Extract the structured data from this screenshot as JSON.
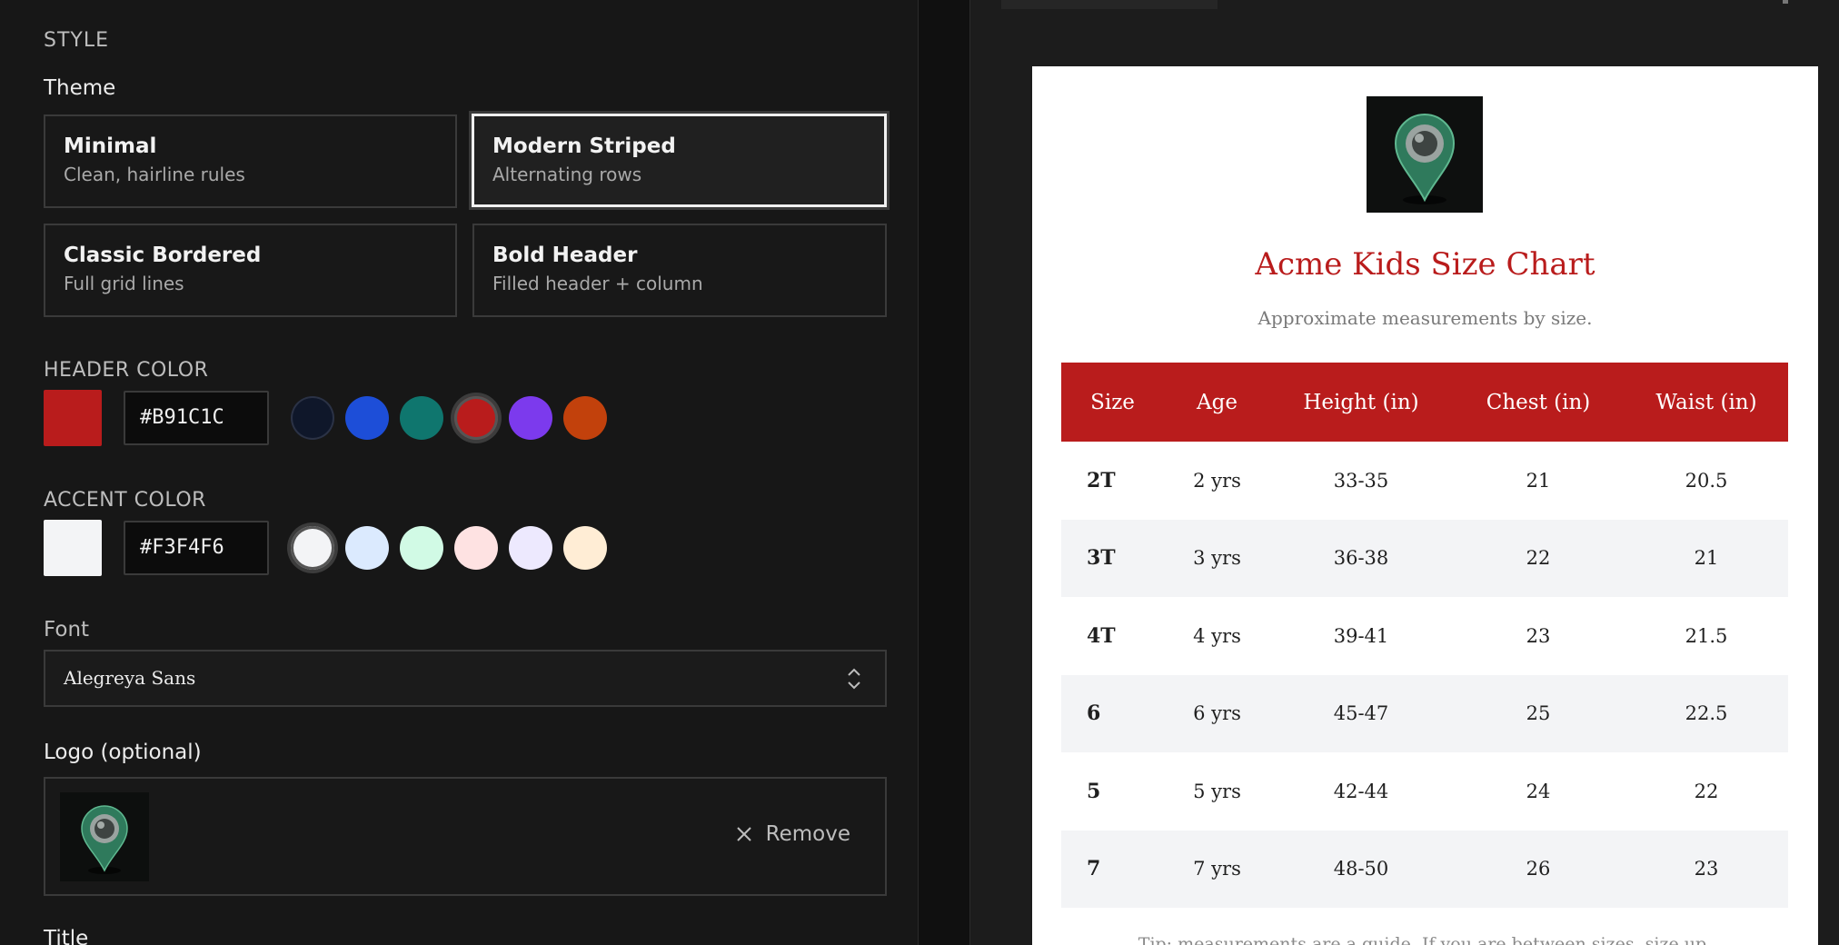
{
  "style_section": {
    "title": "STYLE",
    "theme_label": "Theme",
    "themes": [
      {
        "name": "Minimal",
        "desc": "Clean, hairline rules"
      },
      {
        "name": "Modern Striped",
        "desc": "Alternating rows"
      },
      {
        "name": "Classic Bordered",
        "desc": "Full grid lines"
      },
      {
        "name": "Bold Header",
        "desc": "Filled header + column"
      }
    ],
    "selected_theme": "Modern Striped"
  },
  "header_color": {
    "label": "HEADER COLOR",
    "value": "#B91C1C",
    "presets": [
      "#0f172a",
      "#1d4ed8",
      "#0f766e",
      "#b91c1c",
      "#7c3aed",
      "#c2410c"
    ],
    "selected": "#b91c1c"
  },
  "accent_color": {
    "label": "ACCENT COLOR",
    "value": "#F3F4F6",
    "presets": [
      "#f3f4f6",
      "#dbeafe",
      "#d1fae5",
      "#fee2e2",
      "#ede9fe",
      "#ffedd5"
    ],
    "selected": "#f3f4f6"
  },
  "font": {
    "label": "Font",
    "value": "Alegreya Sans"
  },
  "logo": {
    "label": "Logo (optional)",
    "remove_label": "Remove"
  },
  "title_field": {
    "label": "Title"
  },
  "preview": {
    "title": "Acme Kids Size Chart",
    "subtitle": "Approximate measurements by size.",
    "columns": [
      "Size",
      "Age",
      "Height (in)",
      "Chest (in)",
      "Waist (in)"
    ],
    "rows": [
      [
        "2T",
        "2 yrs",
        "33-35",
        "21",
        "20.5"
      ],
      [
        "3T",
        "3 yrs",
        "36-38",
        "22",
        "21"
      ],
      [
        "4T",
        "4 yrs",
        "39-41",
        "23",
        "21.5"
      ],
      [
        "6",
        "6 yrs",
        "45-47",
        "25",
        "22.5"
      ],
      [
        "5",
        "5 yrs",
        "42-44",
        "24",
        "22"
      ],
      [
        "7",
        "7 yrs",
        "48-50",
        "26",
        "23"
      ]
    ],
    "footnote": "Tip: measurements are a guide. If you are between sizes, size up.",
    "header_color": "#B91C1C",
    "stripe_color": "#F3F4F6"
  }
}
